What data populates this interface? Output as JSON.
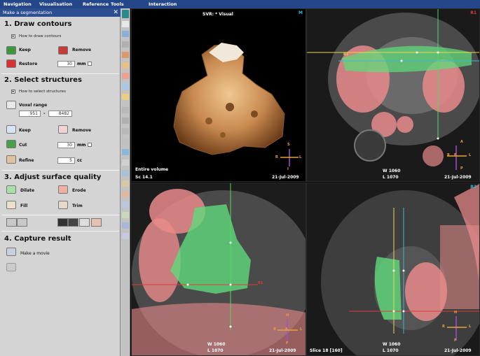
{
  "menubar": {
    "items": [
      "Navigation",
      "Visualisation",
      "Reference",
      "Tools",
      "Interaction"
    ]
  },
  "panel": {
    "title": "Make a segmentation",
    "close": "✕",
    "draw": {
      "title": "1. Draw contours",
      "help": "How to draw contours",
      "keep": "Keep",
      "remove": "Remove",
      "restore": "Restore",
      "restore_value": "30",
      "restore_unit": "mm"
    },
    "select": {
      "title": "2. Select structures",
      "help": "How to select structures",
      "voxel_label": "Voxel range",
      "voxel_min": "951",
      "voxel_dash": "-",
      "voxel_max": "8482",
      "keep": "Keep",
      "remove": "Remove",
      "cut": "Cut",
      "cut_value": "30",
      "cut_unit": "mm",
      "refine": "Refine",
      "refine_value": "5",
      "refine_unit": "cc"
    },
    "adjust": {
      "title": "3. Adjust surface quality",
      "dilate": "Dilate",
      "erode": "Erode",
      "fill": "Fill",
      "trim": "Trim"
    },
    "capture": {
      "title": "4. Capture result",
      "movie": "Make a movie"
    }
  },
  "viewports": {
    "vr": {
      "title": "SVR:  * Visual",
      "tag": "M",
      "bottom_left_1": "Entire volume",
      "bottom_left_2": "Sc 14.1",
      "date": "21-Jul-2009",
      "orient": [
        "S",
        "R",
        "L",
        "I"
      ]
    },
    "r1": {
      "tag": "R1",
      "wl_w": "W 1060",
      "wl_l": "L 1070",
      "date": "21-Jul-2009",
      "orient": [
        "A",
        "R",
        "F",
        "L",
        "P"
      ],
      "marker": "R1"
    },
    "bl": {
      "wl_w": "W 1060",
      "wl_l": "L 1070",
      "date": "21-Jul-2009",
      "orient": [
        "H",
        "R",
        "A",
        "L",
        "F"
      ],
      "marker": "R1"
    },
    "r2": {
      "tag": "R2",
      "slice": "Slice 18  [160]",
      "wl_w": "W 1060",
      "wl_l": "L 1070",
      "date": "21-Jul-2009",
      "orient": [
        "H",
        "R",
        "L",
        "F"
      ]
    }
  },
  "colors": {
    "menubar": "#24478a",
    "panel_bg": "#d4d4d4",
    "segmentation_green": "#5fd97a",
    "blood_pool_pink": "#e88a8a",
    "crosshair_yellow": "#e8d84a",
    "crosshair_cyan": "#38b8d8",
    "crosshair_green": "#4fdc5a",
    "crosshair_red": "#e03a3a",
    "orientation_orange": "#e8a23a",
    "orientation_purple": "#a24fd0"
  }
}
